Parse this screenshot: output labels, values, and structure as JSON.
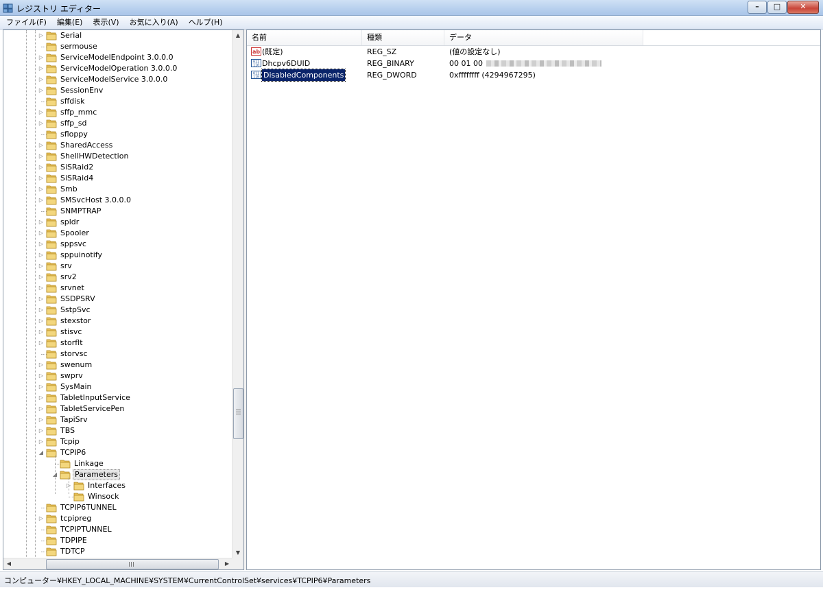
{
  "window": {
    "title": "レジストリ エディター",
    "close_glyph": "✕",
    "min_glyph": "–",
    "max_glyph": "□"
  },
  "menu": [
    {
      "label": "ファイル(F)"
    },
    {
      "label": "編集(E)"
    },
    {
      "label": "表示(V)"
    },
    {
      "label": "お気に入り(A)"
    },
    {
      "label": "ヘルプ(H)"
    }
  ],
  "tree": {
    "items": [
      {
        "label": "Serial",
        "expandable": true
      },
      {
        "label": "sermouse",
        "expandable": false
      },
      {
        "label": "ServiceModelEndpoint 3.0.0.0",
        "expandable": true
      },
      {
        "label": "ServiceModelOperation 3.0.0.0",
        "expandable": true
      },
      {
        "label": "ServiceModelService 3.0.0.0",
        "expandable": true
      },
      {
        "label": "SessionEnv",
        "expandable": true
      },
      {
        "label": "sffdisk",
        "expandable": false
      },
      {
        "label": "sffp_mmc",
        "expandable": true
      },
      {
        "label": "sffp_sd",
        "expandable": true
      },
      {
        "label": "sfloppy",
        "expandable": false
      },
      {
        "label": "SharedAccess",
        "expandable": true
      },
      {
        "label": "ShellHWDetection",
        "expandable": true
      },
      {
        "label": "SiSRaid2",
        "expandable": true
      },
      {
        "label": "SiSRaid4",
        "expandable": true
      },
      {
        "label": "Smb",
        "expandable": true
      },
      {
        "label": "SMSvcHost 3.0.0.0",
        "expandable": true
      },
      {
        "label": "SNMPTRAP",
        "expandable": false
      },
      {
        "label": "spldr",
        "expandable": true
      },
      {
        "label": "Spooler",
        "expandable": true
      },
      {
        "label": "sppsvc",
        "expandable": true
      },
      {
        "label": "sppuinotify",
        "expandable": true
      },
      {
        "label": "srv",
        "expandable": true
      },
      {
        "label": "srv2",
        "expandable": true
      },
      {
        "label": "srvnet",
        "expandable": true
      },
      {
        "label": "SSDPSRV",
        "expandable": true
      },
      {
        "label": "SstpSvc",
        "expandable": true
      },
      {
        "label": "stexstor",
        "expandable": true
      },
      {
        "label": "stisvc",
        "expandable": true
      },
      {
        "label": "storflt",
        "expandable": true
      },
      {
        "label": "storvsc",
        "expandable": false
      },
      {
        "label": "swenum",
        "expandable": true
      },
      {
        "label": "swprv",
        "expandable": true
      },
      {
        "label": "SysMain",
        "expandable": true
      },
      {
        "label": "TabletInputService",
        "expandable": true
      },
      {
        "label": "TabletServicePen",
        "expandable": true
      },
      {
        "label": "TapiSrv",
        "expandable": true
      },
      {
        "label": "TBS",
        "expandable": true
      },
      {
        "label": "Tcpip",
        "expandable": true
      },
      {
        "label": "TCPIP6",
        "expandable": true,
        "expanded": true
      },
      {
        "label": "Linkage",
        "expandable": false,
        "level": 1
      },
      {
        "label": "Parameters",
        "expandable": true,
        "expanded": true,
        "level": 1,
        "selected": true
      },
      {
        "label": "Interfaces",
        "expandable": true,
        "level": 2
      },
      {
        "label": "Winsock",
        "expandable": false,
        "level": 2
      },
      {
        "label": "TCPIP6TUNNEL",
        "expandable": false
      },
      {
        "label": "tcpipreg",
        "expandable": true
      },
      {
        "label": "TCPIPTUNNEL",
        "expandable": false
      },
      {
        "label": "TDPIPE",
        "expandable": false
      },
      {
        "label": "TDTCP",
        "expandable": false
      }
    ]
  },
  "list": {
    "columns": {
      "name": "名前",
      "type": "種類",
      "data": "データ"
    },
    "rows": [
      {
        "icon": "string-value-icon",
        "name": "(既定)",
        "type": "REG_SZ",
        "data": "(値の設定なし)"
      },
      {
        "icon": "binary-value-icon",
        "name": "Dhcpv6DUID",
        "type": "REG_BINARY",
        "data": "00 01 00",
        "redacted": true
      },
      {
        "icon": "binary-value-icon",
        "name": "DisabledComponents",
        "type": "REG_DWORD",
        "data": "0xffffffff (4294967295)",
        "selected": true
      }
    ]
  },
  "status": {
    "path": "コンピューター¥HKEY_LOCAL_MACHINE¥SYSTEM¥CurrentControlSet¥services¥TCPIP6¥Parameters"
  },
  "colors": {
    "selection": "#0a246a",
    "folder": "#e8c15a",
    "title_bar": "#b9d1ee"
  }
}
